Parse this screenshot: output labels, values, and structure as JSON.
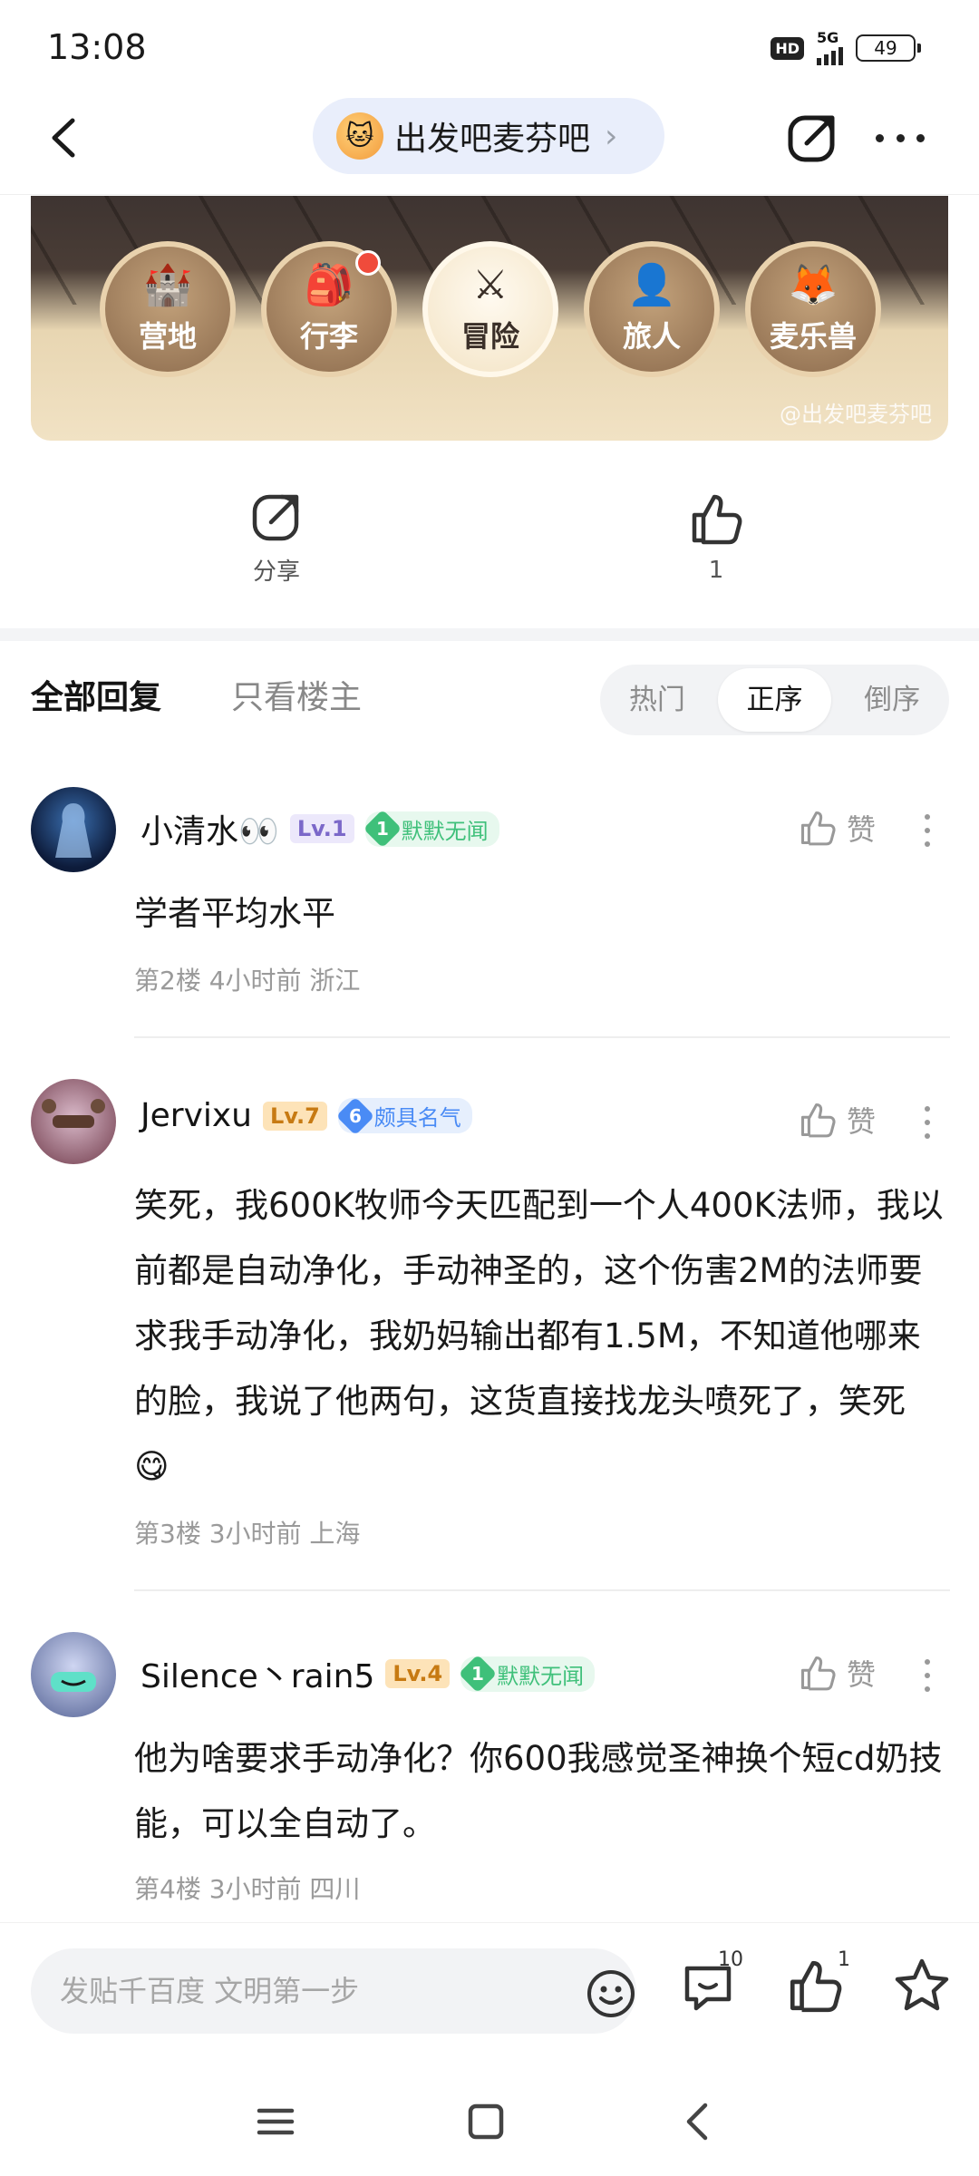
{
  "status_bar": {
    "time": "13:08",
    "hd": "HD",
    "network": "5G",
    "battery": "49"
  },
  "header": {
    "forum_name": "出发吧麦芬吧",
    "forum_chevron": "›"
  },
  "banner": {
    "tabs": [
      {
        "label": "营地",
        "icon": "castle-icon",
        "glyph": "🏰"
      },
      {
        "label": "行李",
        "icon": "backpack-icon",
        "glyph": "🎒"
      },
      {
        "label": "冒险",
        "icon": "crossed-swords-icon",
        "glyph": "⚔"
      },
      {
        "label": "旅人",
        "icon": "traveler-icon",
        "glyph": "👤"
      },
      {
        "label": "麦乐兽",
        "icon": "fox-icon",
        "glyph": "🦊"
      }
    ],
    "watermark": "@出发吧麦芬吧"
  },
  "actions": {
    "share_label": "分享",
    "like_count": "1"
  },
  "reply_tabs": {
    "all": "全部回复",
    "op_only": "只看楼主"
  },
  "sort": {
    "hot": "热门",
    "asc": "正序",
    "desc": "倒序",
    "selected": "正序"
  },
  "comments": [
    {
      "username": "小清水👀",
      "level": "Lv.1",
      "title_num": "1",
      "title": "默默无闻",
      "like_label": "赞",
      "text": "学者平均水平",
      "meta": "第2楼   4小时前   浙江"
    },
    {
      "username": "Jervixu",
      "level": "Lv.7",
      "title_num": "6",
      "title": "颇具名气",
      "like_label": "赞",
      "text": "笑死，我600K牧师今天匹配到一个人400K法师，我以前都是自动净化，手动神圣的，这个伤害2M的法师要求我手动净化，我奶妈输出都有1.5M，不知道他哪来的脸，我说了他两句，这货直接找龙头喷死了，笑死 😋",
      "meta": "第3楼   3小时前   上海"
    },
    {
      "username": "Silence丶rain5",
      "level": "Lv.4",
      "title_num": "1",
      "title": "默默无闻",
      "like_label": "赞",
      "text": "他为啥要求手动净化？你600我感觉圣神换个短cd奶技能，可以全自动了。",
      "meta": "第4楼   3小时前   四川"
    }
  ],
  "bottom_bar": {
    "input_placeholder": "发贴千百度 文明第一步",
    "comment_count": "10",
    "like_count": "1"
  },
  "colors": {
    "accent": "#3388ff",
    "lv1_bg": "#ece8fb",
    "lv1_fg": "#7b68c9",
    "lv_orange_bg": "#fde3b8",
    "lv_orange_fg": "#c77a12",
    "title_green": "#3fc07a",
    "title_blue": "#4a8bf5"
  }
}
